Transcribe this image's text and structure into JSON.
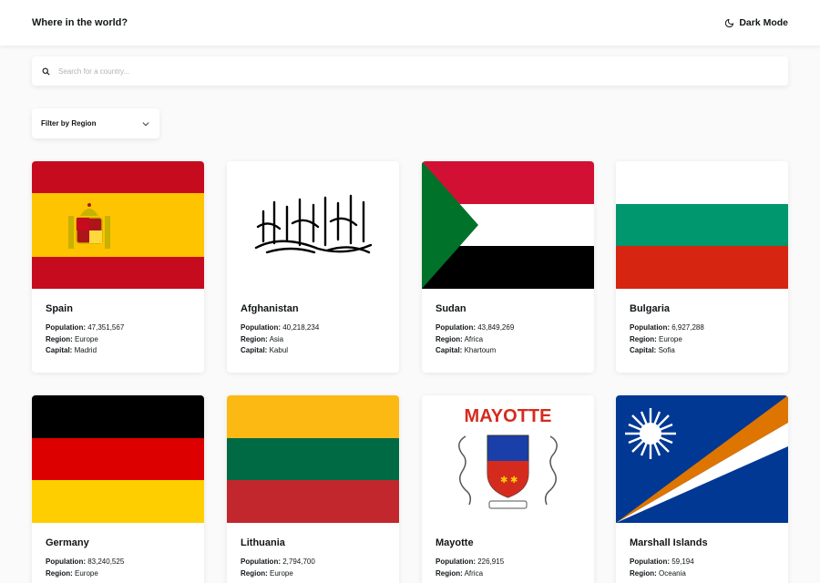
{
  "header": {
    "title": "Where in the world?",
    "dark_mode_label": "Dark Mode"
  },
  "search": {
    "placeholder": "Search for a country...",
    "value": ""
  },
  "filter": {
    "label": "Filter by Region"
  },
  "labels": {
    "population": "Population:",
    "region": "Region:",
    "capital": "Capital:"
  },
  "countries": [
    {
      "name": "Spain",
      "population": "47,351,567",
      "region": "Europe",
      "capital": "Madrid"
    },
    {
      "name": "Afghanistan",
      "population": "40,218,234",
      "region": "Asia",
      "capital": "Kabul"
    },
    {
      "name": "Sudan",
      "population": "43,849,269",
      "region": "Africa",
      "capital": "Khartoum"
    },
    {
      "name": "Bulgaria",
      "population": "6,927,288",
      "region": "Europe",
      "capital": "Sofia"
    },
    {
      "name": "Germany",
      "population": "83,240,525",
      "region": "Europe",
      "capital": ""
    },
    {
      "name": "Lithuania",
      "population": "2,794,700",
      "region": "Europe",
      "capital": ""
    },
    {
      "name": "Mayotte",
      "population": "226,915",
      "region": "Africa",
      "capital": ""
    },
    {
      "name": "Marshall Islands",
      "population": "59,194",
      "region": "Oceania",
      "capital": ""
    }
  ],
  "flag_text": {
    "mayotte": "MAYOTTE"
  },
  "colors": {
    "spain_red": "#c60b1e",
    "spain_yellow": "#ffc400",
    "sudan_red": "#d21034",
    "sudan_green": "#007229",
    "bulgaria_green": "#00966e",
    "bulgaria_red": "#d62612",
    "germany_red": "#dd0000",
    "germany_gold": "#ffce00",
    "lithuania_yellow": "#fdb913",
    "lithuania_green": "#006a44",
    "lithuania_red": "#c1272d",
    "mayotte_red": "#d52b1e",
    "marshall_blue": "#003893",
    "marshall_orange": "#dd7500"
  }
}
